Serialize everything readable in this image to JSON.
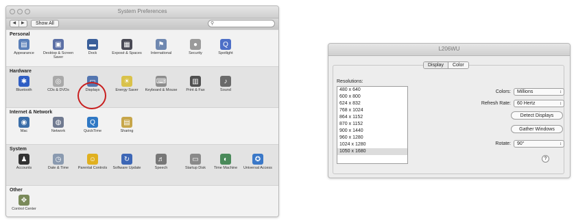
{
  "sysprefs": {
    "title": "System Preferences",
    "nav_back": "◀",
    "nav_forward": "▶",
    "show_all": "Show All",
    "search_placeholder": "",
    "categories": [
      {
        "name": "Personal",
        "panes": [
          {
            "label": "Appearance",
            "icon": "appearance-icon",
            "glyph": "▤",
            "color": "#5a7fb8"
          },
          {
            "label": "Desktop & Screen Saver",
            "icon": "desktop-icon",
            "glyph": "▣",
            "color": "#5b6fa5"
          },
          {
            "label": "Dock",
            "icon": "dock-icon",
            "glyph": "▬",
            "color": "#3a5f9a"
          },
          {
            "label": "Exposé & Spaces",
            "icon": "expose-icon",
            "glyph": "▦",
            "color": "#4a4a55"
          },
          {
            "label": "International",
            "icon": "flag-icon",
            "glyph": "⚑",
            "color": "#6f88b0"
          },
          {
            "label": "Security",
            "icon": "lock-icon",
            "glyph": "●",
            "color": "#9a9a9a"
          },
          {
            "label": "Spotlight",
            "icon": "spotlight-icon",
            "glyph": "Q",
            "color": "#4d6fc7"
          }
        ]
      },
      {
        "name": "Hardware",
        "panes": [
          {
            "label": "Bluetooth",
            "icon": "bluetooth-icon",
            "glyph": "✱",
            "color": "#2f5ec4"
          },
          {
            "label": "CDs & DVDs",
            "icon": "disc-icon",
            "glyph": "◎",
            "color": "#a9a9a9"
          },
          {
            "label": "Displays",
            "icon": "display-icon",
            "glyph": "▭",
            "color": "#5476b0"
          },
          {
            "label": "Energy Saver",
            "icon": "bulb-icon",
            "glyph": "☀",
            "color": "#d9c24a"
          },
          {
            "label": "Keyboard & Mouse",
            "icon": "keyboard-icon",
            "glyph": "⌨",
            "color": "#8d8d8d"
          },
          {
            "label": "Print & Fax",
            "icon": "printer-icon",
            "glyph": "▥",
            "color": "#505050"
          },
          {
            "label": "Sound",
            "icon": "speaker-icon",
            "glyph": "♪",
            "color": "#6a6a6a"
          }
        ]
      },
      {
        "name": "Internet & Network",
        "panes": [
          {
            "label": "Mac",
            "icon": "mac-icon",
            "glyph": "◉",
            "color": "#3b6ea8"
          },
          {
            "label": "Network",
            "icon": "network-icon",
            "glyph": "◍",
            "color": "#707a90"
          },
          {
            "label": "QuickTime",
            "icon": "quicktime-icon",
            "glyph": "Q",
            "color": "#2f78c4"
          },
          {
            "label": "Sharing",
            "icon": "sharing-icon",
            "glyph": "▤",
            "color": "#c7a64a"
          }
        ]
      },
      {
        "name": "System",
        "panes": [
          {
            "label": "Accounts",
            "icon": "accounts-icon",
            "glyph": "♟",
            "color": "#333333"
          },
          {
            "label": "Date & Time",
            "icon": "clock-icon",
            "glyph": "◷",
            "color": "#8a9ab0"
          },
          {
            "label": "Parental Controls",
            "icon": "parental-icon",
            "glyph": "☺",
            "color": "#e0b020"
          },
          {
            "label": "Software Update",
            "icon": "update-icon",
            "glyph": "↻",
            "color": "#3d67b6"
          },
          {
            "label": "Speech",
            "icon": "microphone-icon",
            "glyph": "♬",
            "color": "#777777"
          },
          {
            "label": "Startup Disk",
            "icon": "harddisk-icon",
            "glyph": "▭",
            "color": "#8a8a8a"
          },
          {
            "label": "Time Machine",
            "icon": "timemachine-icon",
            "glyph": "◐",
            "color": "#4a8a5a"
          },
          {
            "label": "Universal Access",
            "icon": "accessibility-icon",
            "glyph": "✪",
            "color": "#3a78c8"
          }
        ]
      },
      {
        "name": "Other",
        "panes": [
          {
            "label": "Control Center",
            "icon": "logitech-icon",
            "glyph": "✥",
            "color": "#7a8a5a"
          }
        ]
      }
    ]
  },
  "display": {
    "title": "L206WU",
    "tabs": [
      "Display",
      "Color"
    ],
    "selected_tab": "Display",
    "resolutions_label": "Resolutions:",
    "resolutions": [
      "480 x 640",
      "600 x 800",
      "624 x 832",
      "768 x 1024",
      "864 x 1152",
      "870 x 1152",
      "900 x 1440",
      "960 x 1280",
      "1024 x 1280",
      "1050 x 1680"
    ],
    "selected_resolution": "1050 x 1680",
    "colors_label": "Colors:",
    "colors_value": "Millions",
    "refresh_label": "Refresh Rate:",
    "refresh_value": "60 Hertz",
    "detect_button": "Detect Displays",
    "gather_button": "Gather Windows",
    "rotate_label": "Rotate:",
    "rotate_value": "90°",
    "help": "?"
  }
}
